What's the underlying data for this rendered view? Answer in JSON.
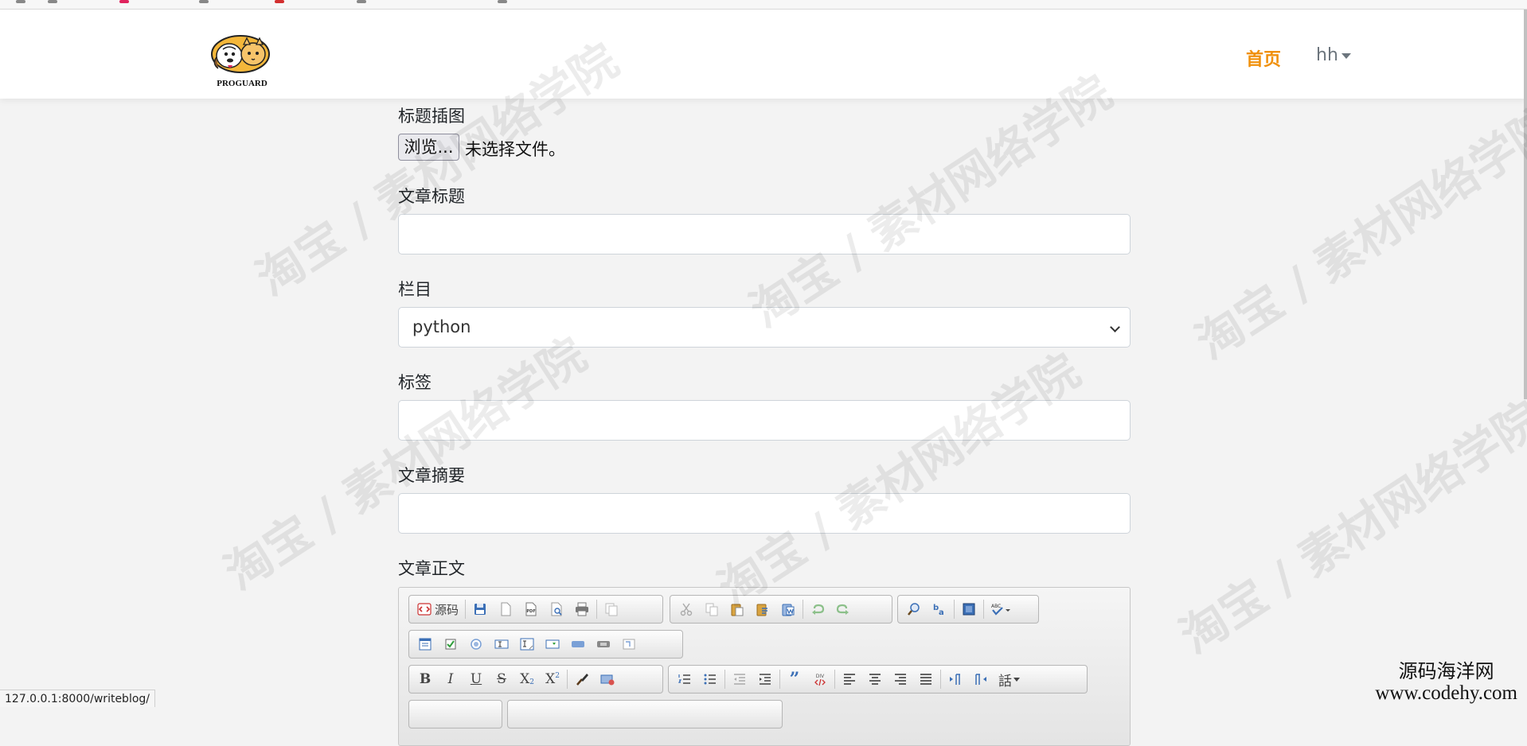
{
  "browser": {
    "status_url": "127.0.0.1:8000/writeblog/"
  },
  "navbar": {
    "logo_text": "PROGUARD",
    "home_label": "首页",
    "user_label": "hh"
  },
  "form": {
    "cover_image": {
      "label": "标题插图",
      "browse_label": "浏览...",
      "status": "未选择文件。"
    },
    "title": {
      "label": "文章标题",
      "value": ""
    },
    "column": {
      "label": "栏目",
      "selected": "python"
    },
    "tags": {
      "label": "标签",
      "value": ""
    },
    "summary": {
      "label": "文章摘要",
      "value": ""
    },
    "body": {
      "label": "文章正文",
      "toolbar": {
        "source_label": "源码",
        "pdf_label": "PDF",
        "abc_label": "ABC",
        "div_label": "DIV",
        "bold": "B",
        "italic": "I",
        "underline": "U",
        "strike": "S",
        "subscript": "X",
        "superscript": "X",
        "language_label": "話"
      }
    }
  },
  "watermark": {
    "tile_text": "淘宝 / 素材网络学院",
    "corner_cn": "源码海洋网",
    "corner_en": "www.codehy.com"
  }
}
